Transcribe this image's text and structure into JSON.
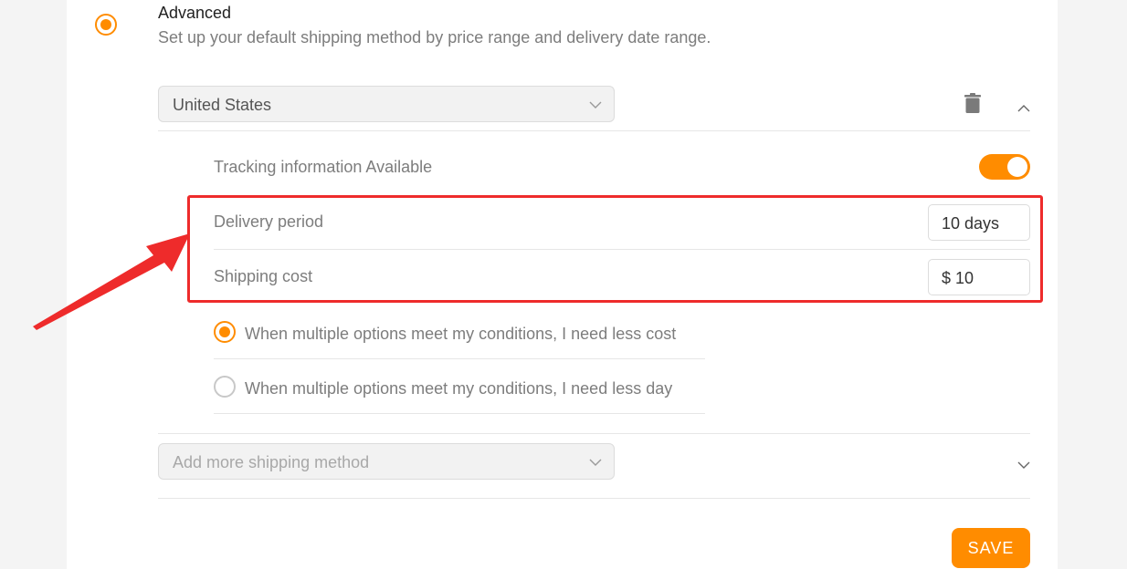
{
  "advanced": {
    "title": "Advanced",
    "description": "Set up your default shipping method by price range and delivery date range."
  },
  "country_select": {
    "value": "United States"
  },
  "tracking": {
    "label": "Tracking information Available",
    "enabled": true
  },
  "delivery_period": {
    "label": "Delivery period",
    "value": "10 days"
  },
  "shipping_cost": {
    "label": "Shipping cost",
    "value": "$ 10"
  },
  "preference_options": [
    {
      "label": "When multiple options meet my conditions, I need less cost",
      "selected": true
    },
    {
      "label": "When multiple options meet my conditions, I need less day",
      "selected": false
    }
  ],
  "add_method_select": {
    "placeholder": "Add more shipping method"
  },
  "save_button": {
    "label": "SAVE"
  },
  "colors": {
    "accent": "#ff8c00",
    "annotation": "#ee2b2b"
  },
  "icons": [
    "trash-icon",
    "chevron-up-icon",
    "chevron-down-icon"
  ]
}
